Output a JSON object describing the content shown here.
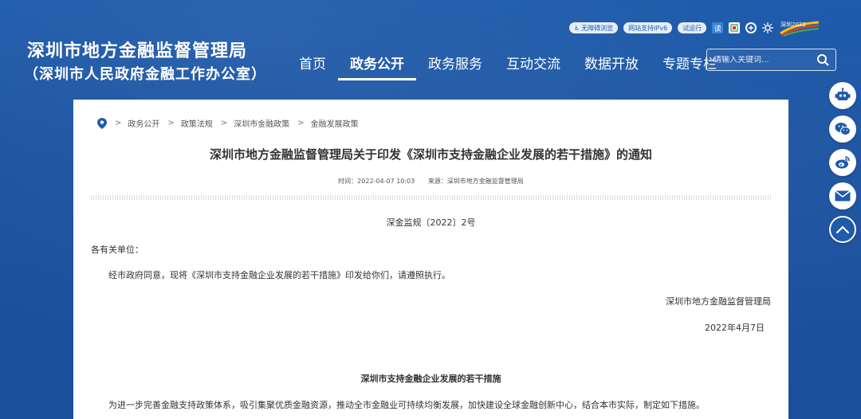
{
  "header": {
    "title": "深圳市地方金融监督管理局",
    "subtitle": "（深圳市人民政府金融工作办公室）",
    "utility": {
      "accessibility": "无障碍浏览",
      "ipv6": "网站支持IPv6",
      "trial": "试运行",
      "read_icon": "读",
      "logo_text": "深圳2022"
    },
    "nav": [
      "首页",
      "政务公开",
      "政务服务",
      "互动交流",
      "数据开放",
      "专题专栏"
    ],
    "nav_active_index": 1,
    "search": {
      "placeholder": "请输入关键词..."
    }
  },
  "breadcrumb": [
    "政务公开",
    "政策法规",
    "深圳市金融政策",
    "金融发展政策"
  ],
  "article": {
    "title": "深圳市地方金融监督管理局关于印发《深圳市支持金融企业发展的若干措施》的通知",
    "time": "时间：2022-04-07 10:03",
    "source": "来源：深圳市地方金融监督管理局",
    "doc_no": "深金监规〔2022〕2号",
    "salutation": "各有关单位：",
    "body": "经市政府同意，现将《深圳市支持金融企业发展的若干措施》印发给你们，请遵照执行。",
    "signature": "深圳市地方金融监督管理局",
    "date": "2022年4月7日",
    "section_title": "深圳市支持金融企业发展的若干措施",
    "intro": "为进一步完善金融支持政策体系，吸引集聚优质金融资源，推动全市金融业可持续均衡发展，加快建设全球金融创新中心，结合本市实际，制定如下措施。"
  },
  "float_bar": [
    "robot-icon",
    "wechat-icon",
    "weibo-icon",
    "mail-icon",
    "back-to-top-icon"
  ],
  "colors": {
    "brand": "#1e5bab",
    "white": "#ffffff",
    "text": "#333333"
  }
}
